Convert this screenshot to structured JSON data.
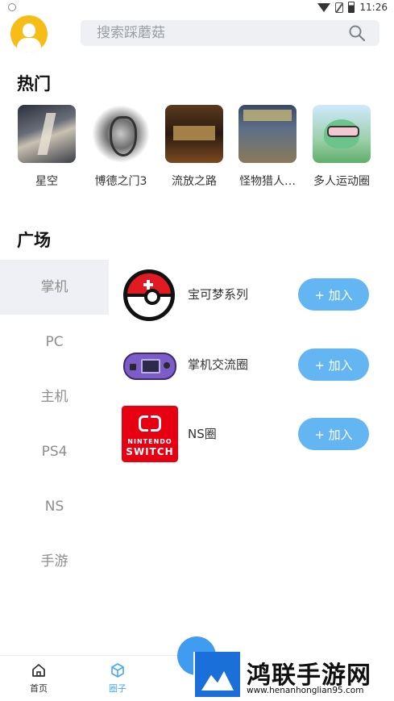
{
  "status_bar": {
    "time": "11:26"
  },
  "search": {
    "placeholder": "搜索踩蘑菇"
  },
  "hot": {
    "title": "热门",
    "items": [
      {
        "label": "星空",
        "icon": "starfield-thumb"
      },
      {
        "label": "博德之门3",
        "icon": "baldurs-gate-thumb"
      },
      {
        "label": "流放之路",
        "icon": "path-of-exile-thumb"
      },
      {
        "label": "怪物猎人…",
        "icon": "monster-hunter-thumb"
      },
      {
        "label": "多人运动圈",
        "icon": "multiplayer-thumb"
      }
    ]
  },
  "square": {
    "title": "广场",
    "categories": [
      {
        "label": "掌机",
        "active": true
      },
      {
        "label": "PC",
        "active": false
      },
      {
        "label": "主机",
        "active": false
      },
      {
        "label": "PS4",
        "active": false
      },
      {
        "label": "NS",
        "active": false
      },
      {
        "label": "手游",
        "active": false
      }
    ],
    "circles": [
      {
        "name": "宝可梦系列",
        "icon": "pokeball-icon",
        "join_label": "+ 加入"
      },
      {
        "name": "掌机交流圈",
        "icon": "gameboy-advance-icon",
        "join_label": "+ 加入"
      },
      {
        "name": "NS圈",
        "icon": "nintendo-switch-icon",
        "join_label": "+ 加入",
        "icon_text_top": "NINTENDO",
        "icon_text_bottom": "SWITCH"
      }
    ]
  },
  "bottom_nav": {
    "items": [
      {
        "label": "首页",
        "icon": "home-icon",
        "active": false
      },
      {
        "label": "圈子",
        "icon": "cube-icon",
        "active": true
      }
    ]
  },
  "watermark": {
    "title": "鸿联手游网",
    "url": "www.henanhonglian95.com"
  },
  "colors": {
    "accent": "#63b6f2",
    "nav_active": "#4aa8ee",
    "avatar": "#f6bd17",
    "category_active_bg": "#eef0f5"
  }
}
